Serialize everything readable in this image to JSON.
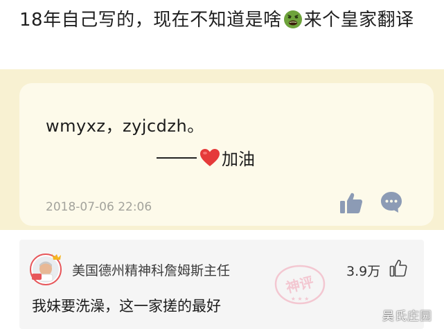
{
  "post": {
    "title_part1": "18年自己写的，现在不知道是啥",
    "title_part2": "来个皇家翻译",
    "emoji_icon": "nauseated-face-icon"
  },
  "diary": {
    "line1": "wmyxz，zyjcdzh。",
    "line2": "加油",
    "date": "2018-07-06 22:06",
    "bg_color": "#f8f1d2",
    "card_color": "#fdfaea"
  },
  "comment": {
    "username": "美国德州精神科詹姆斯主任",
    "likes": "3.9万",
    "text": "我妹要洗澡，这一家搓的最好",
    "stamp_text": "神评"
  },
  "watermark": "吴氏庄园"
}
